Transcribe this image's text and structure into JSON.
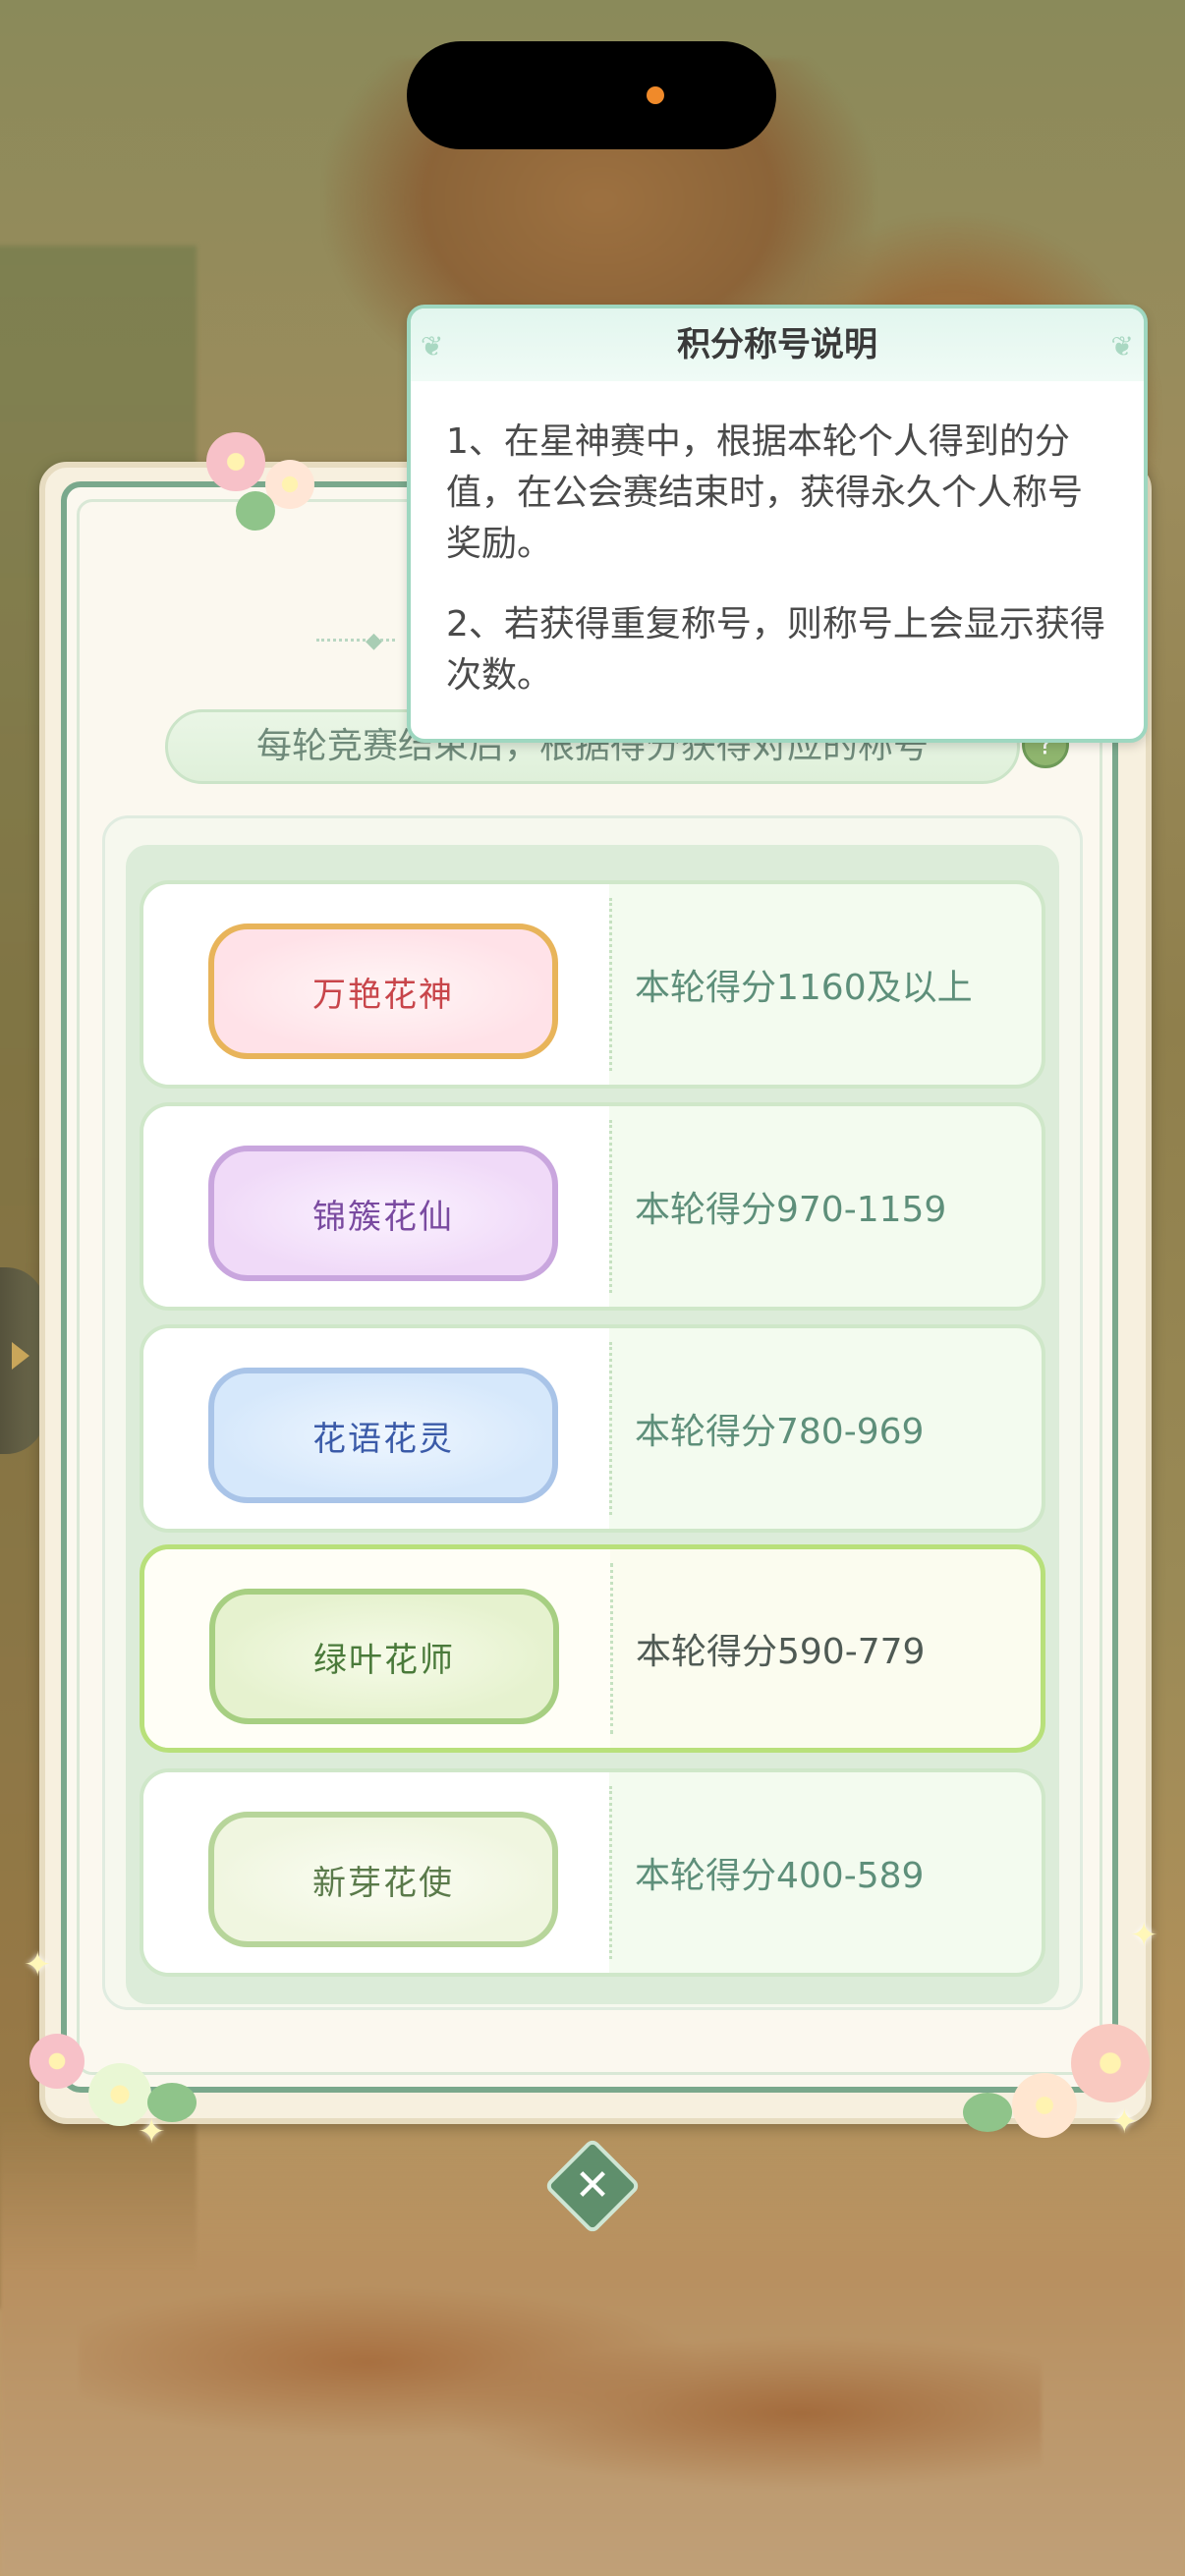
{
  "popup": {
    "title": "积分称号说明",
    "para1": "1、在星神赛中，根据本轮个人得到的分值，在公会赛结束时，获得永久个人称号奖励。",
    "para2": "2、若获得重复称号，则称号上会显示获得次数。"
  },
  "banner": {
    "text": "每轮竞赛结束后，根据得分获得对应的称号"
  },
  "titles": [
    {
      "name": "万艳花神",
      "score": "本轮得分1160及以上",
      "theme": "pink-gold",
      "highlighted": false
    },
    {
      "name": "锦簇花仙",
      "score": "本轮得分970-1159",
      "theme": "purple",
      "highlighted": false
    },
    {
      "name": "花语花灵",
      "score": "本轮得分780-969",
      "theme": "blue",
      "highlighted": false
    },
    {
      "name": "绿叶花师",
      "score": "本轮得分590-779",
      "theme": "green",
      "highlighted": true
    },
    {
      "name": "新芽花使",
      "score": "本轮得分400-589",
      "theme": "light-green",
      "highlighted": false
    }
  ],
  "icons": {
    "help": "help-icon",
    "close": "close-icon",
    "side_arrow": "chevron-right-icon"
  },
  "colors": {
    "panel_border": "#7aa88c",
    "popup_border": "#9ed7c0",
    "score_text": "#5e8f7a",
    "highlight_border": "#b8e07a"
  }
}
